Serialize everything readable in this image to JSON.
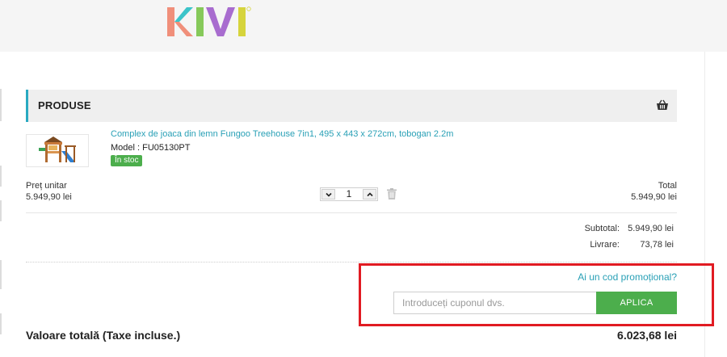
{
  "brand": {
    "logo_text": "KIVI",
    "logo_colors": [
      "#f08f7a",
      "#3cc4c9",
      "#86c95a",
      "#a86ccf",
      "#d6d43c"
    ]
  },
  "cart": {
    "section_title": "PRODUSE",
    "product": {
      "name": "Complex de joaca din lemn Fungoo Treehouse 7in1, 495 x 443 x 272cm, tobogan 2.2m",
      "model": "Model : FU05130PT",
      "stock": "În stoc",
      "unit_price_label": "Preț unitar",
      "unit_price": "5.949,90 lei",
      "quantity": "1",
      "total_label": "Total",
      "total": "5.949,90 lei"
    }
  },
  "summary": {
    "subtotal_label": "Subtotal:",
    "subtotal_value": "5.949,90 lei",
    "shipping_label": "Livrare:",
    "shipping_value": "73,78 lei"
  },
  "promo": {
    "link_text": "Ai un cod promoțional?",
    "input_placeholder": "Introduceți cuponul dvs.",
    "apply_label": "APLICA"
  },
  "grand_total": {
    "label": "Valoare totală (Taxe incluse.)",
    "value": "6.023,68 lei"
  },
  "colors": {
    "accent": "#29a9c1",
    "success": "#4cae4c",
    "highlight": "#e11b22"
  },
  "icons": [
    "basket-icon",
    "chevron-down-icon",
    "chevron-up-icon",
    "trash-icon"
  ]
}
